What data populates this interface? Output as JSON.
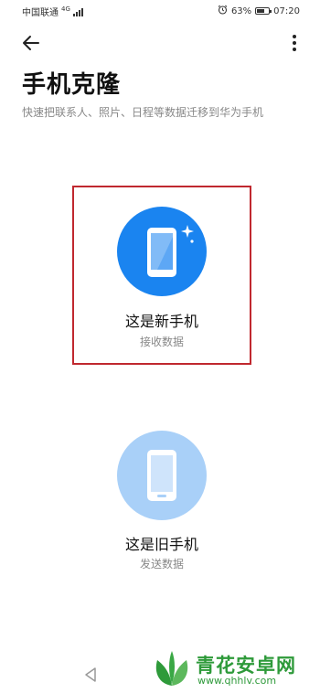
{
  "status_bar": {
    "carrier": "中国联通",
    "network": "4G",
    "battery_percent": "63%",
    "battery_level": 0.63,
    "time": "07:20",
    "icons": [
      "alarm-icon",
      "battery-icon",
      "signal-icon"
    ]
  },
  "header": {
    "back_icon": "arrow-left-icon",
    "more_icon": "more-vertical-icon",
    "title": "手机克隆",
    "subtitle": "快速把联系人、照片、日程等数据迁移到华为手机"
  },
  "options": [
    {
      "label": "这是新手机",
      "sublabel": "接收数据",
      "icon": "phone-sparkle-icon",
      "color": "#1a84f0",
      "highlight_color": "#c0282f"
    },
    {
      "label": "这是旧手机",
      "sublabel": "发送数据",
      "icon": "phone-old-icon",
      "color": "#a9d0f8"
    }
  ],
  "nav_bar": {
    "back_icon": "nav-back-triangle-icon"
  },
  "watermark": {
    "title": "青花安卓网",
    "url": "www.qhhlv.com",
    "color": "#2e9a3a"
  }
}
